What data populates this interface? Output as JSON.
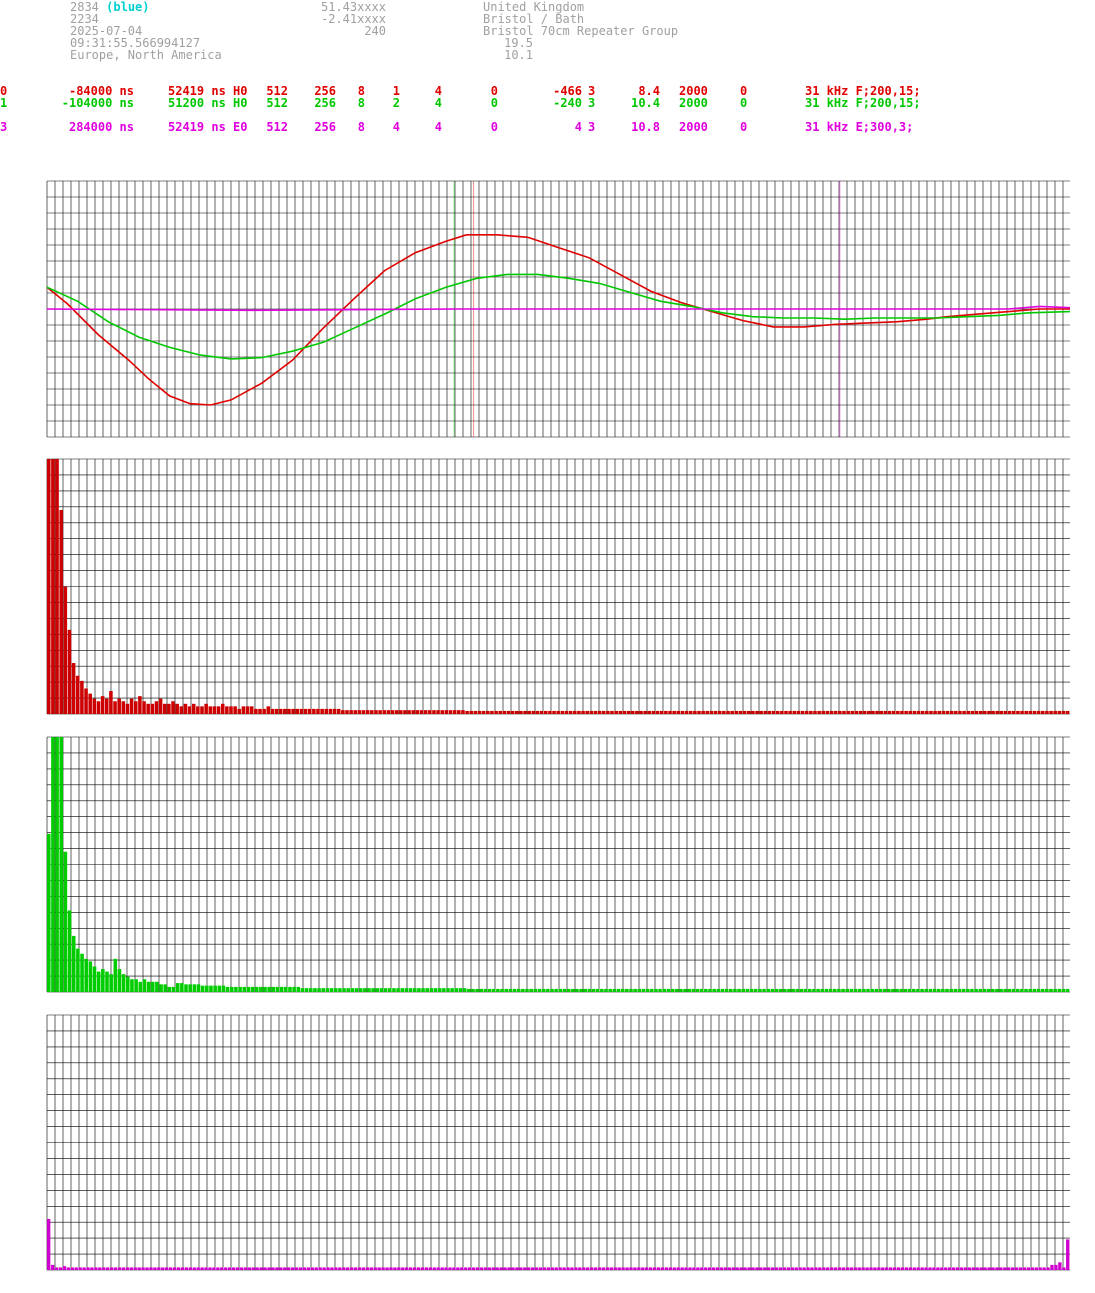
{
  "header": {
    "id_number": "2834",
    "id_color": "(blue)",
    "line2": "2234",
    "date": "2025-07-04",
    "time": "09:31:55.566994127",
    "region": "Europe, North America",
    "lat": "51.43xxxx",
    "lon": "-2.41xxxx",
    "alt": "240",
    "country": "United Kingdom",
    "city": "Bristol / Bath",
    "group": "Bristol 70cm Repeater Group",
    "val1": "19.5",
    "val2": "10.1"
  },
  "channels": [
    {
      "idx": "0",
      "offset": "-84000 ns",
      "period": "52419 ns H0",
      "a": "512",
      "b": "256",
      "c": "8",
      "d": "1",
      "e": "4",
      "f": "0",
      "g": "-466",
      "h": "3",
      "snr": "8.4",
      "n": "2000",
      "z": "0",
      "bw": "31 kHz F;200,15;",
      "color": "#e00000"
    },
    {
      "idx": "1",
      "offset": "-104000 ns",
      "period": "51200 ns H0",
      "a": "512",
      "b": "256",
      "c": "8",
      "d": "2",
      "e": "4",
      "f": "0",
      "g": "-240",
      "h": "3",
      "snr": "10.4",
      "n": "2000",
      "z": "0",
      "bw": "31 kHz F;200,15;",
      "color": "#00c800"
    },
    {
      "idx": "3",
      "offset": "284000 ns",
      "period": "52419 ns E0",
      "a": "512",
      "b": "256",
      "c": "8",
      "d": "4",
      "e": "4",
      "f": "0",
      "g": "4",
      "h": "3",
      "snr": "10.8",
      "n": "2000",
      "z": "0",
      "bw": "31 kHz E;300,3;",
      "color": "#e000e0"
    }
  ],
  "chart_data": [
    {
      "type": "line",
      "xlim": [
        0,
        1
      ],
      "ylim": [
        -1,
        1
      ],
      "grid": true,
      "markers": [
        {
          "x": 0.398,
          "color": "#00c800"
        },
        {
          "x": 0.417,
          "color": "#e00000"
        },
        {
          "x": 0.775,
          "color": "#e000e0"
        }
      ],
      "series": [
        {
          "color": "#e00000",
          "points": [
            [
              0,
              0.17
            ],
            [
              0.02,
              0.04
            ],
            [
              0.05,
              -0.2
            ],
            [
              0.08,
              -0.4
            ],
            [
              0.1,
              -0.55
            ],
            [
              0.12,
              -0.68
            ],
            [
              0.14,
              -0.74
            ],
            [
              0.16,
              -0.75
            ],
            [
              0.18,
              -0.71
            ],
            [
              0.21,
              -0.58
            ],
            [
              0.24,
              -0.4
            ],
            [
              0.27,
              -0.15
            ],
            [
              0.3,
              0.08
            ],
            [
              0.33,
              0.3
            ],
            [
              0.36,
              0.44
            ],
            [
              0.39,
              0.53
            ],
            [
              0.41,
              0.58
            ],
            [
              0.44,
              0.58
            ],
            [
              0.47,
              0.56
            ],
            [
              0.5,
              0.48
            ],
            [
              0.53,
              0.4
            ],
            [
              0.56,
              0.27
            ],
            [
              0.59,
              0.14
            ],
            [
              0.62,
              0.05
            ],
            [
              0.65,
              -0.02
            ],
            [
              0.68,
              -0.09
            ],
            [
              0.71,
              -0.14
            ],
            [
              0.74,
              -0.14
            ],
            [
              0.77,
              -0.12
            ],
            [
              0.8,
              -0.11
            ],
            [
              0.83,
              -0.1
            ],
            [
              0.86,
              -0.08
            ],
            [
              0.88,
              -0.06
            ],
            [
              0.91,
              -0.04
            ],
            [
              0.94,
              -0.02
            ],
            [
              0.97,
              0.0
            ],
            [
              1.0,
              0.0
            ]
          ]
        },
        {
          "color": "#00c800",
          "points": [
            [
              0,
              0.17
            ],
            [
              0.03,
              0.06
            ],
            [
              0.06,
              -0.1
            ],
            [
              0.09,
              -0.22
            ],
            [
              0.12,
              -0.3
            ],
            [
              0.15,
              -0.36
            ],
            [
              0.18,
              -0.39
            ],
            [
              0.21,
              -0.38
            ],
            [
              0.24,
              -0.33
            ],
            [
              0.27,
              -0.26
            ],
            [
              0.3,
              -0.15
            ],
            [
              0.33,
              -0.04
            ],
            [
              0.36,
              0.08
            ],
            [
              0.39,
              0.17
            ],
            [
              0.42,
              0.24
            ],
            [
              0.45,
              0.27
            ],
            [
              0.48,
              0.27
            ],
            [
              0.51,
              0.24
            ],
            [
              0.54,
              0.2
            ],
            [
              0.57,
              0.13
            ],
            [
              0.6,
              0.06
            ],
            [
              0.63,
              0.02
            ],
            [
              0.66,
              -0.03
            ],
            [
              0.69,
              -0.06
            ],
            [
              0.72,
              -0.07
            ],
            [
              0.75,
              -0.07
            ],
            [
              0.78,
              -0.08
            ],
            [
              0.81,
              -0.07
            ],
            [
              0.84,
              -0.07
            ],
            [
              0.87,
              -0.07
            ],
            [
              0.9,
              -0.06
            ],
            [
              0.93,
              -0.05
            ],
            [
              0.96,
              -0.03
            ],
            [
              1.0,
              -0.02
            ]
          ]
        },
        {
          "color": "#e000e0",
          "points": [
            [
              0,
              0.0
            ],
            [
              0.2,
              -0.01
            ],
            [
              0.4,
              0.0
            ],
            [
              0.6,
              0.0
            ],
            [
              0.8,
              0.0
            ],
            [
              0.94,
              0.0
            ],
            [
              0.97,
              0.02
            ],
            [
              1.0,
              0.01
            ]
          ]
        }
      ]
    },
    {
      "type": "bar",
      "color": "#cc0000",
      "ylim": [
        0,
        1
      ],
      "grid": true,
      "values": [
        1.0,
        1.0,
        1.0,
        0.8,
        0.5,
        0.33,
        0.2,
        0.15,
        0.13,
        0.1,
        0.08,
        0.06,
        0.05,
        0.07,
        0.06,
        0.09,
        0.05,
        0.06,
        0.05,
        0.04,
        0.06,
        0.05,
        0.07,
        0.05,
        0.04,
        0.04,
        0.05,
        0.06,
        0.04,
        0.04,
        0.05,
        0.04,
        0.03,
        0.04,
        0.03,
        0.04,
        0.03,
        0.03,
        0.04,
        0.03,
        0.03,
        0.03,
        0.04,
        0.03,
        0.03,
        0.03,
        0.02,
        0.03,
        0.03,
        0.03,
        0.02,
        0.02,
        0.02,
        0.03,
        0.02,
        0.02,
        0.02,
        0.02,
        0.02,
        0.02,
        0.02,
        0.02,
        0.02,
        0.02,
        0.02,
        0.02,
        0.02,
        0.02,
        0.02,
        0.02,
        0.02,
        0.015,
        0.015,
        0.015,
        0.015,
        0.015,
        0.015,
        0.015,
        0.015,
        0.015,
        0.015,
        0.015,
        0.015,
        0.015,
        0.015,
        0.015,
        0.015,
        0.015,
        0.015,
        0.015,
        0.015,
        0.015,
        0.015,
        0.015,
        0.015,
        0.015,
        0.015,
        0.015,
        0.015,
        0.015,
        0.015,
        0.012,
        0.012,
        0.012,
        0.012,
        0.012,
        0.012,
        0.012,
        0.012,
        0.012,
        0.012,
        0.012,
        0.012,
        0.012,
        0.012,
        0.012,
        0.012,
        0.012,
        0.012,
        0.012,
        0.012,
        0.012,
        0.012,
        0.012,
        0.012,
        0.012,
        0.012,
        0.012,
        0.012,
        0.012,
        0.012,
        0.012,
        0.012,
        0.012,
        0.012,
        0.012,
        0.012,
        0.012,
        0.012,
        0.012,
        0.012,
        0.012,
        0.012,
        0.012,
        0.012,
        0.012,
        0.012,
        0.012,
        0.012,
        0.012,
        0.012,
        0.012,
        0.012,
        0.012,
        0.012,
        0.012,
        0.012,
        0.012,
        0.012,
        0.012,
        0.012,
        0.012,
        0.012,
        0.012,
        0.012,
        0.012,
        0.012,
        0.012,
        0.012,
        0.012,
        0.012,
        0.012,
        0.012,
        0.012,
        0.012,
        0.012,
        0.012,
        0.012,
        0.012,
        0.012,
        0.012,
        0.012,
        0.012,
        0.012,
        0.012,
        0.012,
        0.012,
        0.012,
        0.012,
        0.012,
        0.012,
        0.012,
        0.012,
        0.012,
        0.012,
        0.012,
        0.012,
        0.012,
        0.012,
        0.012,
        0.012,
        0.012,
        0.012,
        0.012,
        0.012,
        0.012,
        0.012,
        0.012,
        0.012,
        0.012,
        0.012,
        0.012,
        0.012,
        0.012,
        0.012,
        0.012,
        0.012,
        0.012,
        0.012,
        0.012,
        0.012,
        0.012,
        0.012,
        0.012,
        0.012,
        0.012,
        0.012,
        0.012,
        0.012,
        0.012,
        0.012,
        0.012,
        0.012,
        0.012,
        0.012,
        0.012,
        0.012,
        0.012,
        0.012,
        0.012,
        0.012,
        0.012,
        0.012,
        0.012,
        0.012,
        0.012,
        0.012
      ]
    },
    {
      "type": "bar",
      "color": "#00cc00",
      "ylim": [
        0,
        1
      ],
      "grid": true,
      "values": [
        0.62,
        1.0,
        1.0,
        1.0,
        0.55,
        0.32,
        0.22,
        0.17,
        0.15,
        0.13,
        0.12,
        0.1,
        0.08,
        0.09,
        0.08,
        0.07,
        0.13,
        0.09,
        0.07,
        0.06,
        0.05,
        0.05,
        0.04,
        0.05,
        0.04,
        0.04,
        0.04,
        0.03,
        0.03,
        0.02,
        0.02,
        0.035,
        0.035,
        0.03,
        0.03,
        0.03,
        0.03,
        0.025,
        0.025,
        0.025,
        0.025,
        0.025,
        0.025,
        0.02,
        0.02,
        0.02,
        0.02,
        0.02,
        0.02,
        0.02,
        0.02,
        0.02,
        0.02,
        0.02,
        0.02,
        0.02,
        0.02,
        0.02,
        0.02,
        0.02,
        0.02,
        0.015,
        0.015,
        0.015,
        0.015,
        0.015,
        0.015,
        0.015,
        0.015,
        0.015,
        0.015,
        0.015,
        0.015,
        0.015,
        0.015,
        0.015,
        0.015,
        0.015,
        0.015,
        0.015,
        0.015,
        0.015,
        0.015,
        0.015,
        0.015,
        0.015,
        0.015,
        0.015,
        0.015,
        0.015,
        0.015,
        0.015,
        0.015,
        0.015,
        0.015,
        0.015,
        0.015,
        0.015,
        0.015,
        0.015,
        0.015,
        0.012,
        0.012,
        0.012,
        0.012,
        0.012,
        0.012,
        0.012,
        0.012,
        0.012,
        0.012,
        0.012,
        0.012,
        0.012,
        0.012,
        0.012,
        0.012,
        0.012,
        0.012,
        0.012,
        0.012,
        0.012,
        0.012,
        0.012,
        0.012,
        0.012,
        0.012,
        0.012,
        0.012,
        0.012,
        0.012,
        0.012,
        0.012,
        0.012,
        0.012,
        0.012,
        0.012,
        0.012,
        0.012,
        0.012,
        0.012,
        0.012,
        0.012,
        0.012,
        0.012,
        0.012,
        0.012,
        0.012,
        0.012,
        0.012,
        0.012,
        0.012,
        0.012,
        0.012,
        0.012,
        0.012,
        0.012,
        0.012,
        0.012,
        0.012,
        0.012,
        0.012,
        0.012,
        0.012,
        0.012,
        0.012,
        0.012,
        0.012,
        0.012,
        0.012,
        0.012,
        0.012,
        0.012,
        0.012,
        0.012,
        0.012,
        0.012,
        0.012,
        0.012,
        0.012,
        0.012,
        0.012,
        0.012,
        0.012,
        0.012,
        0.012,
        0.012,
        0.012,
        0.012,
        0.012,
        0.012,
        0.012,
        0.012,
        0.012,
        0.012,
        0.012,
        0.012,
        0.012,
        0.012,
        0.012,
        0.012,
        0.012,
        0.012,
        0.012,
        0.012,
        0.012,
        0.012,
        0.012,
        0.012,
        0.012,
        0.012,
        0.012,
        0.012,
        0.012,
        0.012,
        0.012,
        0.012,
        0.012,
        0.012,
        0.012,
        0.012,
        0.012,
        0.012,
        0.012,
        0.012,
        0.012,
        0.012,
        0.012,
        0.012,
        0.012,
        0.012,
        0.012,
        0.012,
        0.012,
        0.012,
        0.012,
        0.012,
        0.012,
        0.012,
        0.012,
        0.012,
        0.012,
        0.012,
        0.012,
        0.012,
        0.012
      ]
    },
    {
      "type": "bar",
      "color": "#d000d0",
      "ylim": [
        0,
        1
      ],
      "grid": true,
      "values": [
        0.2,
        0.02,
        0.01,
        0.01,
        0.015,
        0.01,
        0.01,
        0.01,
        0.01,
        0.01,
        0.01,
        0.01,
        0.01,
        0.01,
        0.01,
        0.01,
        0.01,
        0.01,
        0.01,
        0.01,
        0.01,
        0.01,
        0.01,
        0.01,
        0.01,
        0.01,
        0.01,
        0.01,
        0.01,
        0.01,
        0.01,
        0.01,
        0.01,
        0.01,
        0.01,
        0.01,
        0.01,
        0.01,
        0.01,
        0.01,
        0.01,
        0.01,
        0.01,
        0.01,
        0.01,
        0.01,
        0.01,
        0.01,
        0.01,
        0.01,
        0.01,
        0.01,
        0.01,
        0.01,
        0.01,
        0.01,
        0.01,
        0.01,
        0.01,
        0.01,
        0.01,
        0.01,
        0.01,
        0.01,
        0.01,
        0.01,
        0.01,
        0.01,
        0.01,
        0.01,
        0.01,
        0.01,
        0.01,
        0.01,
        0.01,
        0.01,
        0.01,
        0.01,
        0.01,
        0.01,
        0.01,
        0.01,
        0.01,
        0.01,
        0.01,
        0.01,
        0.01,
        0.01,
        0.01,
        0.01,
        0.01,
        0.01,
        0.01,
        0.01,
        0.01,
        0.01,
        0.01,
        0.01,
        0.01,
        0.01,
        0.01,
        0.01,
        0.01,
        0.01,
        0.01,
        0.01,
        0.01,
        0.01,
        0.01,
        0.01,
        0.01,
        0.01,
        0.01,
        0.01,
        0.01,
        0.01,
        0.01,
        0.01,
        0.01,
        0.01,
        0.01,
        0.01,
        0.01,
        0.01,
        0.01,
        0.01,
        0.01,
        0.01,
        0.01,
        0.01,
        0.01,
        0.01,
        0.01,
        0.01,
        0.01,
        0.01,
        0.01,
        0.01,
        0.01,
        0.01,
        0.01,
        0.01,
        0.01,
        0.01,
        0.01,
        0.01,
        0.01,
        0.01,
        0.01,
        0.01,
        0.01,
        0.01,
        0.01,
        0.01,
        0.01,
        0.01,
        0.01,
        0.01,
        0.01,
        0.01,
        0.01,
        0.01,
        0.01,
        0.01,
        0.01,
        0.01,
        0.01,
        0.01,
        0.01,
        0.01,
        0.01,
        0.01,
        0.01,
        0.01,
        0.01,
        0.01,
        0.01,
        0.01,
        0.01,
        0.01,
        0.01,
        0.01,
        0.01,
        0.01,
        0.01,
        0.01,
        0.01,
        0.01,
        0.01,
        0.01,
        0.01,
        0.01,
        0.01,
        0.01,
        0.01,
        0.01,
        0.01,
        0.01,
        0.01,
        0.01,
        0.01,
        0.01,
        0.01,
        0.01,
        0.01,
        0.01,
        0.01,
        0.01,
        0.01,
        0.01,
        0.01,
        0.01,
        0.01,
        0.01,
        0.01,
        0.01,
        0.01,
        0.01,
        0.01,
        0.01,
        0.01,
        0.01,
        0.01,
        0.01,
        0.01,
        0.01,
        0.01,
        0.01,
        0.01,
        0.01,
        0.01,
        0.01,
        0.01,
        0.01,
        0.01,
        0.01,
        0.01,
        0.01,
        0.01,
        0.01,
        0.01,
        0.01,
        0.01,
        0.01,
        0.01,
        0.01,
        0.01,
        0.01,
        0.01,
        0.01,
        0.01,
        0.01,
        0.01,
        0.01,
        0.01,
        0.02,
        0.02,
        0.03,
        0.01,
        0.12
      ]
    }
  ]
}
